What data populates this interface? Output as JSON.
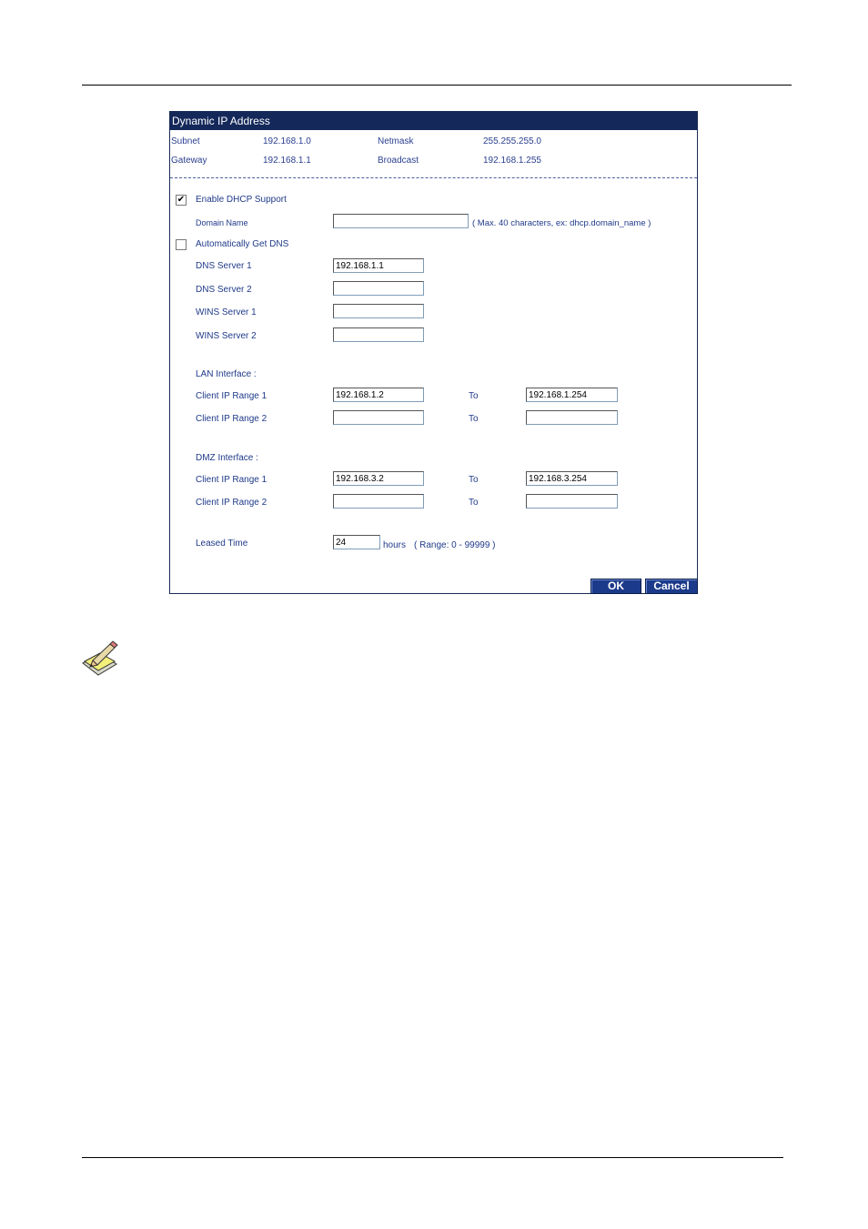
{
  "panel": {
    "title": "Dynamic IP Address",
    "subnet_label": "Subnet",
    "subnet_value": "192.168.1.0",
    "netmask_label": "Netmask",
    "netmask_value": "255.255.255.0",
    "gateway_label": "Gateway",
    "gateway_value": "192.168.1.1",
    "broadcast_label": "Broadcast",
    "broadcast_value": "192.168.1.255"
  },
  "dhcp": {
    "enable_label": "Enable DHCP Support",
    "enable_checked": true,
    "domain_label": "Domain Name",
    "domain_value": "",
    "domain_hint": "( Max. 40 characters, ex: dhcp.domain_name )",
    "auto_dns_label": "Automatically Get DNS",
    "auto_dns_checked": false,
    "dns1_label": "DNS Server 1",
    "dns1_value": "192.168.1.1",
    "dns2_label": "DNS Server 2",
    "dns2_value": "",
    "wins1_label": "WINS Server 1",
    "wins1_value": "",
    "wins2_label": "WINS Server 2",
    "wins2_value": ""
  },
  "lan": {
    "heading": "LAN Interface :",
    "range1_label": "Client IP Range 1",
    "range1_from": "192.168.1.2",
    "range1_to": "192.168.1.254",
    "range2_label": "Client IP Range 2",
    "range2_from": "",
    "range2_to": "",
    "to_label": "To"
  },
  "dmz": {
    "heading": "DMZ Interface :",
    "range1_label": "Client IP Range 1",
    "range1_from": "192.168.3.2",
    "range1_to": "192.168.3.254",
    "range2_label": "Client IP Range 2",
    "range2_from": "",
    "range2_to": "",
    "to_label": "To"
  },
  "lease": {
    "label": "Leased Time",
    "value": "24",
    "unit": "hours",
    "range_hint": "( Range: 0 - 99999 )"
  },
  "buttons": {
    "ok": "OK",
    "cancel": "Cancel"
  },
  "icons": {
    "note": "note-pencil-icon",
    "checkmark": "check-icon"
  }
}
